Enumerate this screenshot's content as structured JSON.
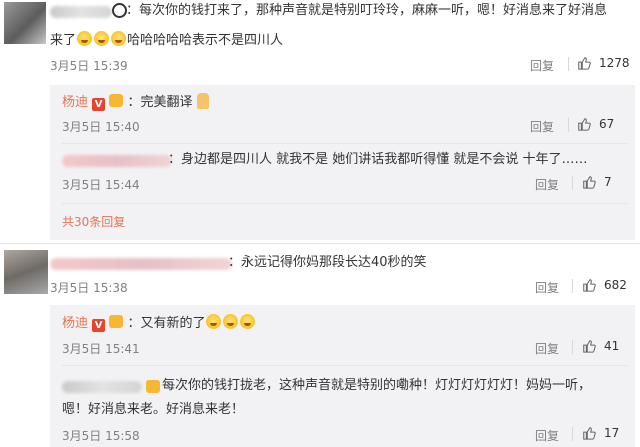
{
  "comments": [
    {
      "text_line1": "：每次你的钱打来了，那种声音就是特别叮玲玲，麻麻一听，嗯！好消息来了好消息",
      "text_line2": "来了",
      "text_line2_tail": "哈哈哈哈哈表示不是四川人",
      "time": "3月5日 15:39",
      "reply": "回复",
      "likes": "1278",
      "replies": [
        {
          "author": "杨迪",
          "text": "：完美翻译",
          "time": "3月5日 15:40",
          "reply": "回复",
          "likes": "67"
        },
        {
          "text": "：身边都是四川人 就我不是 她们讲话我都听得懂 就是不会说 十年了……",
          "time": "3月5日 15:44",
          "reply": "回复",
          "likes": "7"
        }
      ],
      "more": "共30条回复"
    },
    {
      "text_line1": "：永远记得你妈那段长达40秒的笑",
      "time": "3月5日 15:38",
      "reply": "回复",
      "likes": "682",
      "replies": [
        {
          "author": "杨迪",
          "text": "：又有新的了",
          "time": "3月5日 15:41",
          "reply": "回复",
          "likes": "41"
        },
        {
          "text_line1": "每次你的钱打拢老，这种声音就是特别的嘞种！灯灯灯灯灯灯！妈妈一听，",
          "text_line2": "嗯！好消息来老。好消息来老！",
          "time": "3月5日 15:58",
          "reply": "回复",
          "likes": "17"
        }
      ]
    }
  ],
  "colors": {
    "author": "#eb7350",
    "panel": "#f2f2f5",
    "muted": "#808080"
  }
}
